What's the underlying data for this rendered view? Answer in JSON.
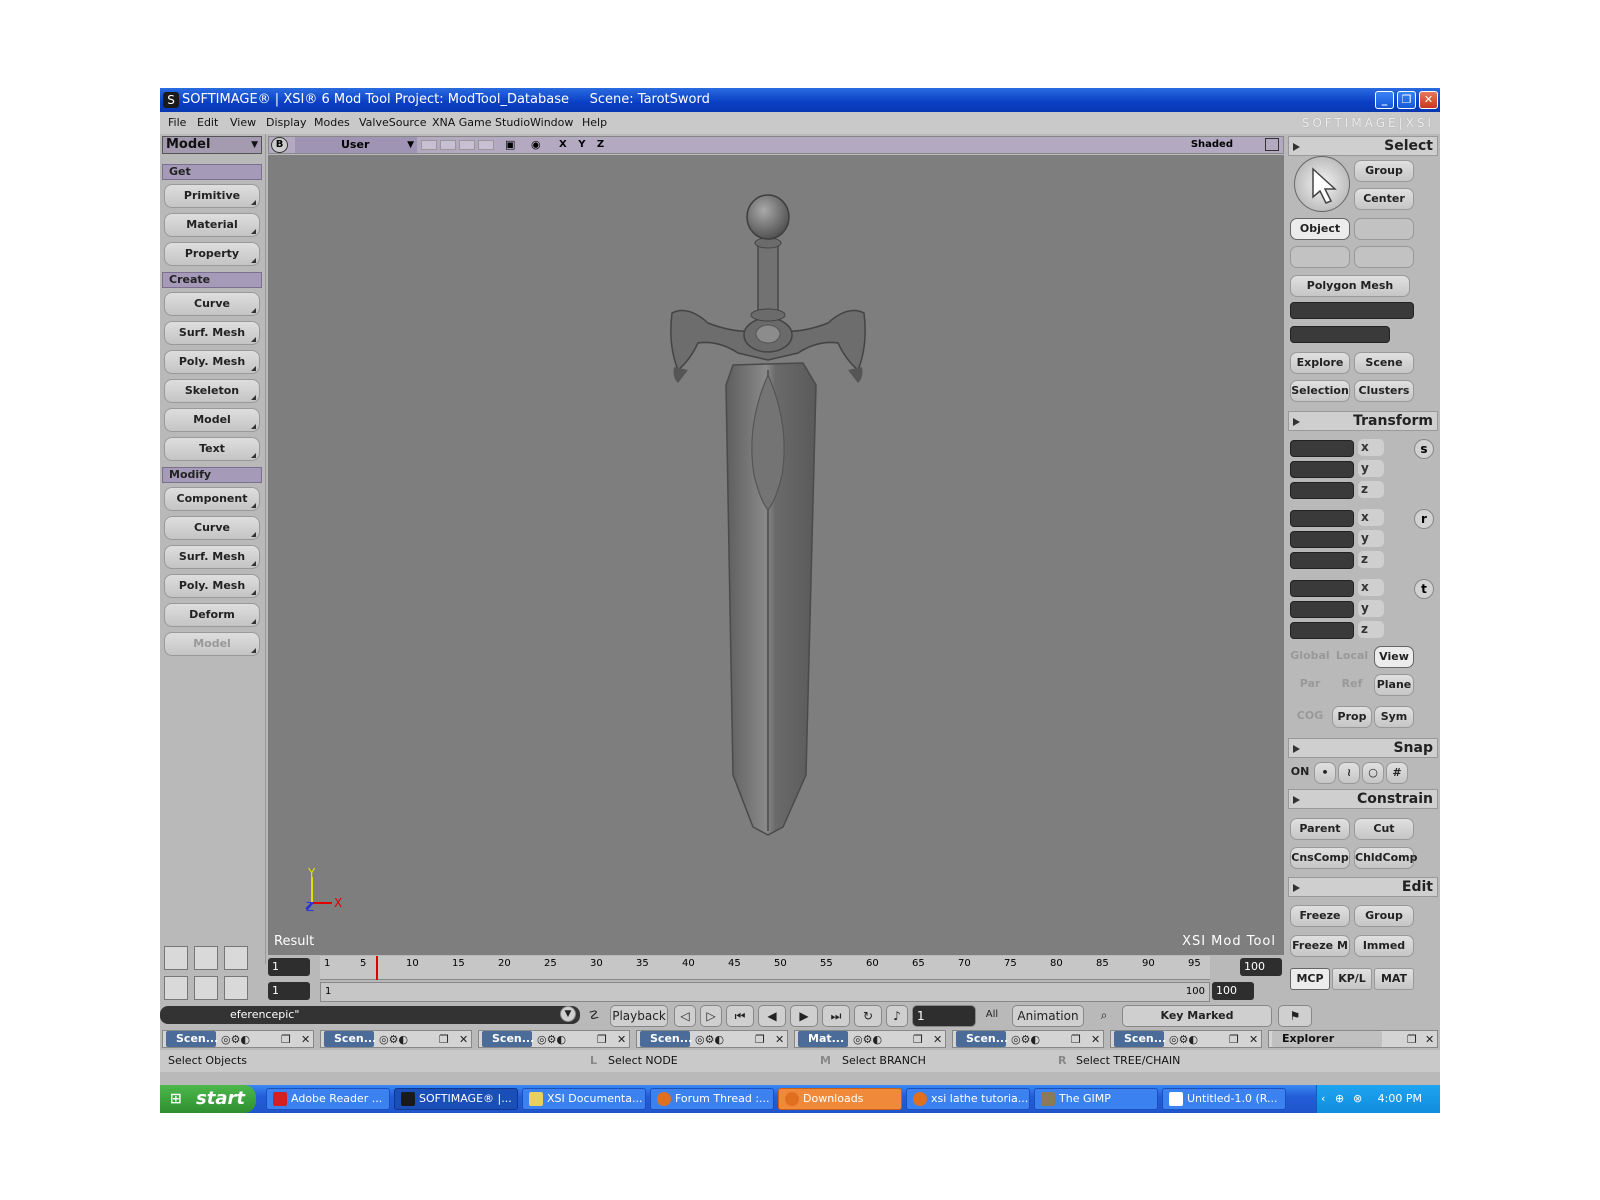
{
  "window": {
    "title": "SOFTIMAGE® | XSI® 6 Mod Tool Project: ModTool_Database     Scene: TarotSword",
    "brand": "SOFTIMAGE|XSI",
    "buttons": {
      "minimize": "_",
      "restore": "❐",
      "close": "✕"
    }
  },
  "menu": [
    "File",
    "Edit",
    "View",
    "Display",
    "Modes",
    "ValveSource",
    "XNA Game Studio",
    "Window",
    "Help"
  ],
  "left_panel": {
    "mode": "Model",
    "sections": [
      {
        "header": "Get",
        "buttons": [
          "Primitive",
          "Material",
          "Property"
        ]
      },
      {
        "header": "Create",
        "buttons": [
          "Curve",
          "Surf. Mesh",
          "Poly. Mesh",
          "Skeleton",
          "Model",
          "Text"
        ]
      },
      {
        "header": "Modify",
        "buttons": [
          "Component",
          "Curve",
          "Surf. Mesh",
          "Poly. Mesh",
          "Deform",
          "Model"
        ]
      }
    ]
  },
  "viewport": {
    "b_button": "B",
    "camera": "User",
    "axes": "X Y Z",
    "display_mode": "Shaded",
    "result_label": "Result",
    "watermark": "XSI Mod Tool",
    "gizmo": {
      "y": "Y",
      "z": "Z",
      "x": "X"
    }
  },
  "right_panel": {
    "select": {
      "header": "Select",
      "group": "Group",
      "center": "Center",
      "object": "Object",
      "filter": "Polygon Mesh",
      "explore": "Explore",
      "scene": "Scene",
      "selection": "Selection",
      "clusters": "Clusters"
    },
    "transform": {
      "header": "Transform",
      "axes": [
        "x",
        "y",
        "z"
      ],
      "srt": [
        "s",
        "r",
        "t"
      ],
      "global": "Global",
      "local": "Local",
      "view": "View",
      "par": "Par",
      "ref": "Ref",
      "plane": "Plane",
      "cog": "COG",
      "prop": "Prop",
      "sym": "Sym"
    },
    "snap": {
      "header": "Snap",
      "on": "ON"
    },
    "constrain": {
      "header": "Constrain",
      "parent": "Parent",
      "cut": "Cut",
      "cnscomp": "CnsComp",
      "chldcomp": "ChldComp"
    },
    "edit": {
      "header": "Edit",
      "freeze": "Freeze",
      "group": "Group",
      "freeze_m": "Freeze M",
      "immed": "Immed"
    },
    "tabs": [
      "MCP",
      "KP/L",
      "MAT"
    ]
  },
  "timeline": {
    "start_frame": "1",
    "current_frame": "1",
    "end_frame": "100",
    "range_start": "1",
    "range_end_small": "100",
    "range_end": "100",
    "ticks": [
      "1",
      "5",
      "10",
      "15",
      "20",
      "25",
      "30",
      "35",
      "40",
      "45",
      "50",
      "55",
      "60",
      "65",
      "70",
      "75",
      "80",
      "85",
      "90",
      "95"
    ]
  },
  "command_line": "eferencepic\"",
  "playback": {
    "playback": "Playback",
    "frame": "1",
    "all": "All",
    "animation": "Animation",
    "key_marked": "Key Marked Parameters"
  },
  "panes": [
    "Scen...",
    "Scen...",
    "Scen...",
    "Scen...",
    "Mat...",
    "Scen...",
    "Scen..."
  ],
  "explorer_pane": "Explorer",
  "status": {
    "left": "Select Objects",
    "l_key": "L",
    "l_text": "Select NODE",
    "m_key": "M",
    "m_text": "Select BRANCH",
    "r_key": "R",
    "r_text": "Select TREE/CHAIN"
  },
  "taskbar": {
    "start": "start",
    "tasks": [
      "Adobe Reader ...",
      "SOFTIMAGE® |...",
      "XSI Documenta...",
      "Forum Thread :...",
      "Downloads",
      "xsi lathe tutoria...",
      "The GIMP",
      "Untitled-1.0 (R..."
    ],
    "clock": "4:00 PM"
  }
}
